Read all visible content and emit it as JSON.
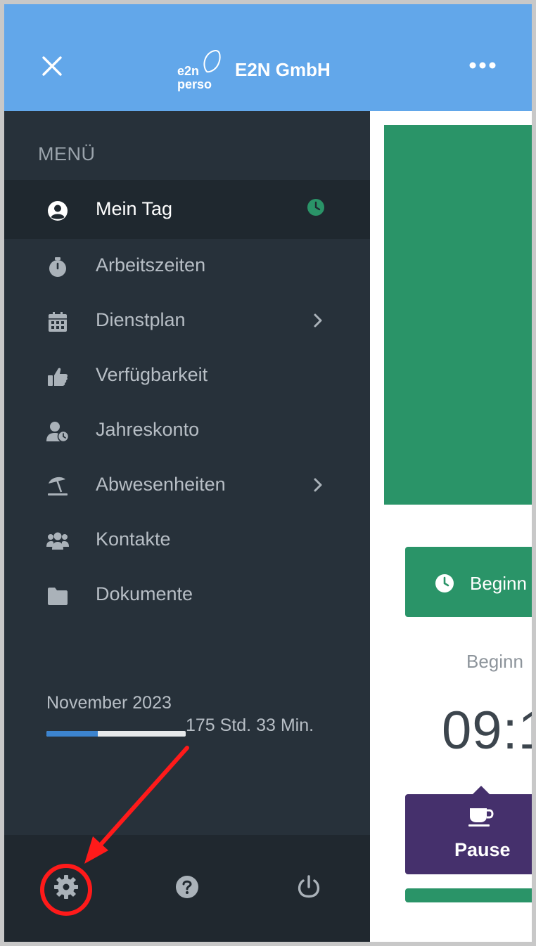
{
  "header": {
    "logo_line1": "e2n",
    "logo_line2": "perso",
    "company": "E2N GmbH",
    "icons": [
      "close-icon",
      "more-icon"
    ]
  },
  "sidebar": {
    "menu_title": "MENÜ",
    "items": [
      {
        "label": "Mein Tag",
        "icon": "user-circle-icon",
        "active": true,
        "badge": "clock-icon"
      },
      {
        "label": "Arbeitszeiten",
        "icon": "stopwatch-icon"
      },
      {
        "label": "Dienstplan",
        "icon": "calendar-icon",
        "chevron": true
      },
      {
        "label": "Verfügbarkeit",
        "icon": "thumbs-up-icon"
      },
      {
        "label": "Jahreskonto",
        "icon": "user-clock-icon"
      },
      {
        "label": "Abwesenheiten",
        "icon": "umbrella-beach-icon",
        "chevron": true
      },
      {
        "label": "Kontakte",
        "icon": "users-icon"
      },
      {
        "label": "Dokumente",
        "icon": "folder-icon"
      }
    ],
    "month": "November 2023",
    "hours": "175 Std. 33 Min.",
    "progress_fraction": 0.37
  },
  "footer": {
    "icons": [
      "gear-icon",
      "help-icon",
      "power-icon"
    ]
  },
  "content": {
    "begin_button": "Beginn",
    "begin_label": "Beginn",
    "time": "09:1",
    "pause_button": "Pause"
  },
  "colors": {
    "header": "#62a7ea",
    "sidebar": "#27313a",
    "green": "#2a9468",
    "purple": "#45306c",
    "annotation": "#ff1a1a"
  }
}
